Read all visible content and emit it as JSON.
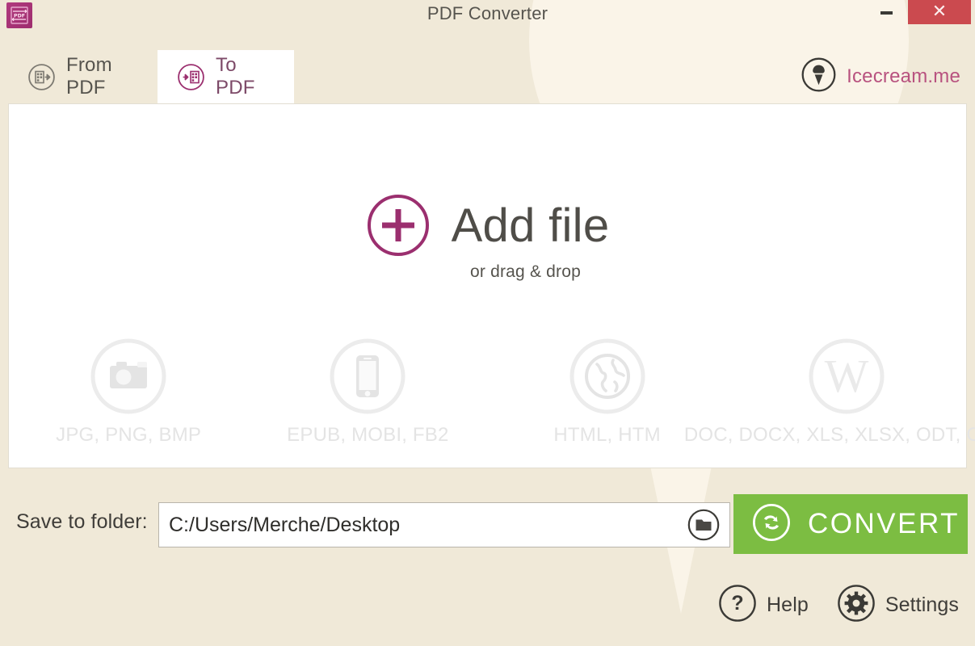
{
  "window": {
    "title": "PDF Converter",
    "app_icon": "pdf-app-icon",
    "minimize_label": "–",
    "close_label": "✕",
    "close_color": "#cb4a4f",
    "background_color": "#f0e9d8"
  },
  "tabs": [
    {
      "id": "from-pdf",
      "label": "From PDF",
      "icon": "from-pdf-icon",
      "active": false
    },
    {
      "id": "to-pdf",
      "label": "To PDF",
      "icon": "to-pdf-icon",
      "active": true
    }
  ],
  "brand": {
    "label": "Icecream.me",
    "icon": "icecream-cone-icon",
    "color": "#b8527f"
  },
  "drop_zone": {
    "title": "Add file",
    "subtitle": "or drag & drop",
    "icon": "plus-circle-icon",
    "accent_color": "#9b2f6f"
  },
  "formats": [
    {
      "id": "images",
      "label": "JPG, PNG, BMP",
      "icon": "camera-icon"
    },
    {
      "id": "ebooks",
      "label": "EPUB, MOBI, FB2",
      "icon": "phone-icon"
    },
    {
      "id": "web",
      "label": "HTML, HTM",
      "icon": "globe-icon"
    },
    {
      "id": "documents",
      "label": "DOC, DOCX, XLS, XLSX, ODT, ODS",
      "icon": "word-w-icon"
    }
  ],
  "save_row": {
    "label": "Save to folder:",
    "path_value": "C:/Users/Merche/Desktop",
    "path_placeholder": "C:/Users/Merche/Desktop",
    "browse_icon": "folder-icon"
  },
  "convert": {
    "label": "CONVERT",
    "icon": "refresh-circle-icon",
    "color": "#7cbd42"
  },
  "bottom_bar": [
    {
      "id": "help",
      "label": "Help",
      "icon": "question-circle-icon"
    },
    {
      "id": "settings",
      "label": "Settings",
      "icon": "gear-circle-icon"
    }
  ]
}
